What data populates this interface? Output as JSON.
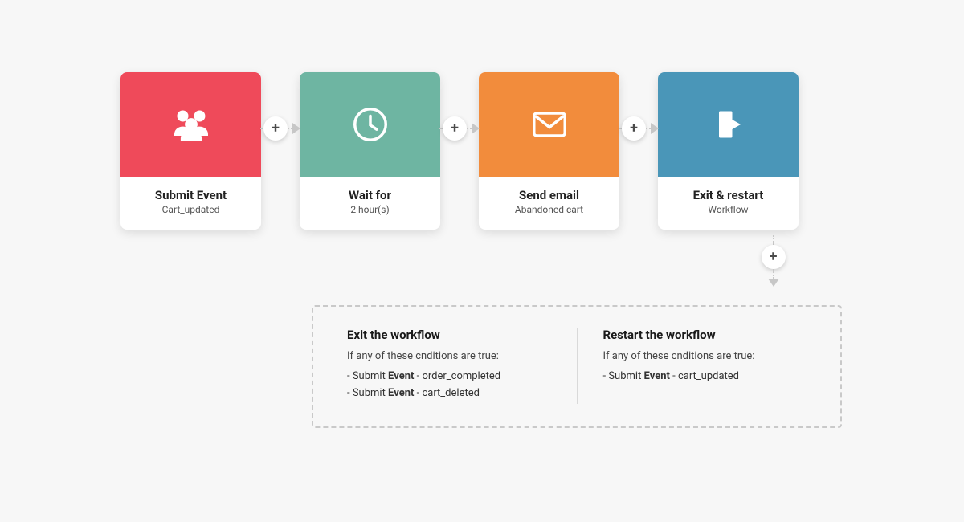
{
  "nodes": {
    "submit": {
      "title": "Submit Event",
      "sub": "Cart_updated",
      "icon": "users-icon",
      "colorClass": "c-red"
    },
    "wait": {
      "title": "Wait for",
      "sub": "2 hour(s)",
      "icon": "clock-icon",
      "colorClass": "c-teal"
    },
    "email": {
      "title": "Send email",
      "sub": "Abandoned cart",
      "icon": "mail-icon",
      "colorClass": "c-orange"
    },
    "exit": {
      "title": "Exit & restart",
      "sub": "Workflow",
      "icon": "exit-icon",
      "colorClass": "c-blue"
    }
  },
  "add_label": "+",
  "details": {
    "exit": {
      "title": "Exit the workflow",
      "sub": "If any of these cnditions are true:",
      "conds": [
        {
          "prefix": "- Submit ",
          "bold": "Event",
          "suffix": " - order_completed"
        },
        {
          "prefix": "- Submit ",
          "bold": "Event",
          "suffix": " - cart_deleted"
        }
      ]
    },
    "restart": {
      "title": "Restart the workflow",
      "sub": "If any of these cnditions are true:",
      "conds": [
        {
          "prefix": "- Submit ",
          "bold": "Event",
          "suffix": " - cart_updated"
        }
      ]
    }
  }
}
